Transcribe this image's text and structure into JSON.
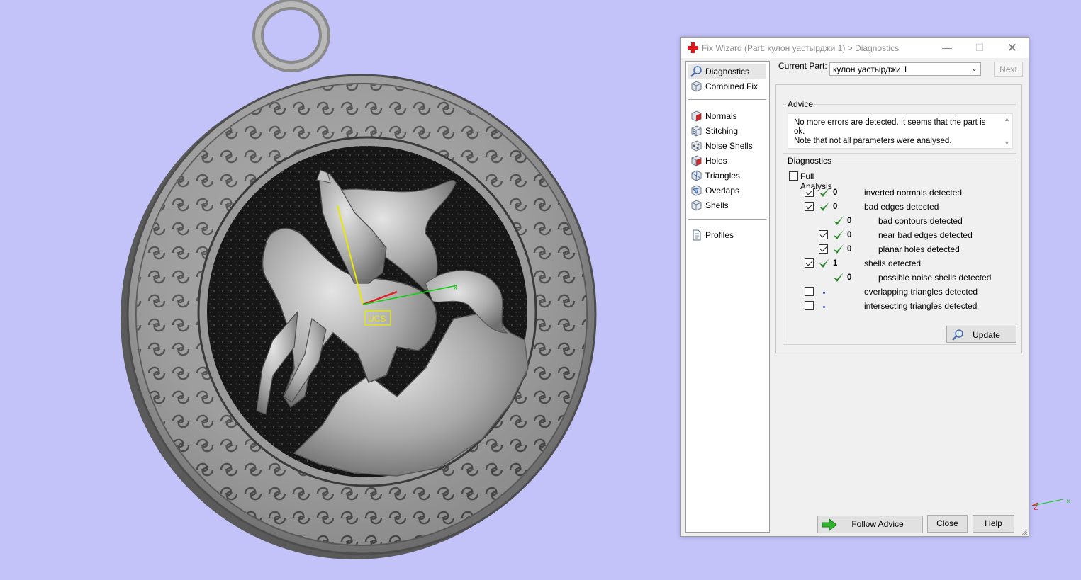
{
  "window": {
    "title": "Fix Wizard (Part: кулон уастырджи 1) > Diagnostics",
    "controls": {
      "minimize": "—",
      "maximize": "☐",
      "close": "✕"
    }
  },
  "nav": {
    "items": [
      {
        "label": "Diagnostics",
        "icon": "magnifier-icon",
        "selected": true
      },
      {
        "label": "Combined Fix",
        "icon": "cube-icon"
      },
      {
        "label": "Normals",
        "icon": "normals-cube-icon"
      },
      {
        "label": "Stitching",
        "icon": "stitching-cube-icon"
      },
      {
        "label": "Noise Shells",
        "icon": "noise-shells-icon"
      },
      {
        "label": "Holes",
        "icon": "holes-cube-icon"
      },
      {
        "label": "Triangles",
        "icon": "triangles-cube-icon"
      },
      {
        "label": "Overlaps",
        "icon": "overlaps-cube-icon"
      },
      {
        "label": "Shells",
        "icon": "shells-cube-icon"
      },
      {
        "label": "Profiles",
        "icon": "document-icon"
      }
    ]
  },
  "current_part": {
    "label": "Current Part:",
    "value": "кулон уастырджи 1"
  },
  "next_button": "Next",
  "advice": {
    "legend": "Advice",
    "line1": "No more errors are detected. It seems that the part is ok.",
    "line2": "Note that not all parameters were analysed."
  },
  "diagnostics": {
    "legend": "Diagnostics",
    "full_analysis": {
      "label": "Full Analysis",
      "checked": false
    },
    "rows": [
      {
        "checkbox": true,
        "checked": true,
        "status": "ok",
        "count": "0",
        "label": "inverted normals detected",
        "indent": 0
      },
      {
        "checkbox": true,
        "checked": true,
        "status": "ok",
        "count": "0",
        "label": "bad edges detected",
        "indent": 0
      },
      {
        "checkbox": false,
        "checked": false,
        "status": "ok",
        "count": "0",
        "label": "bad contours detected",
        "indent": 1
      },
      {
        "checkbox": true,
        "checked": true,
        "status": "ok",
        "count": "0",
        "label": "near bad edges detected",
        "indent": 1
      },
      {
        "checkbox": true,
        "checked": true,
        "status": "ok",
        "count": "0",
        "label": "planar holes detected",
        "indent": 1
      },
      {
        "checkbox": true,
        "checked": true,
        "status": "ok",
        "count": "1",
        "label": "shells detected",
        "indent": 0
      },
      {
        "checkbox": false,
        "checked": false,
        "status": "ok",
        "count": "0",
        "label": "possible noise shells detected",
        "indent": 1
      },
      {
        "checkbox": true,
        "checked": false,
        "status": "pending",
        "count": "",
        "label": "overlapping triangles detected",
        "indent": 0
      },
      {
        "checkbox": true,
        "checked": false,
        "status": "pending",
        "count": "",
        "label": "intersecting triangles detected",
        "indent": 0
      }
    ],
    "update_button": "Update"
  },
  "buttons": {
    "follow_advice": "Follow Advice",
    "close": "Close",
    "help": "Help"
  },
  "viewport": {
    "background": "#c3c3fa",
    "ucs_label": "UCS",
    "triad_label": "Z",
    "model": "pendant-with-horseman-relief"
  },
  "colors": {
    "check_green": "#2a8a2a",
    "dot_blue": "#2a3fbf"
  }
}
